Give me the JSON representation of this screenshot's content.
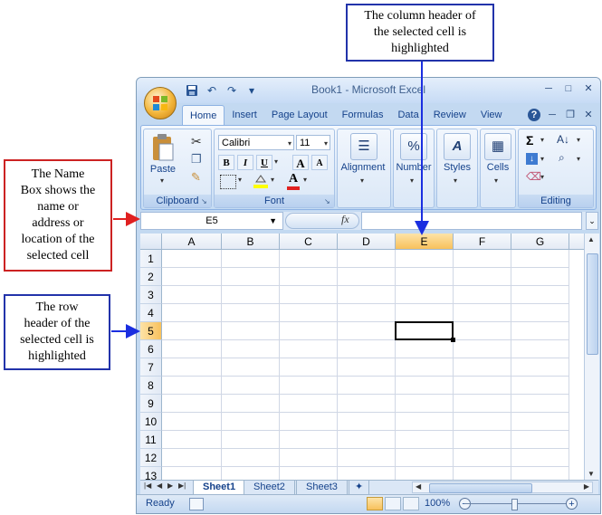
{
  "callouts": {
    "column_header": "The column header of\nthe selected cell is\nhighlighted",
    "name_box": "The Name\nBox shows the\nname or\naddress or\nlocation of the\nselected cell",
    "row_header": "The row\nheader of the\nselected cell is\nhighlighted"
  },
  "window": {
    "title": "Book1 - Microsoft Excel",
    "qat": [
      "save-icon",
      "undo-icon",
      "redo-icon",
      "customize-icon"
    ],
    "tabs": [
      "Home",
      "Insert",
      "Page Layout",
      "Formulas",
      "Data",
      "Review",
      "View"
    ],
    "active_tab": "Home"
  },
  "ribbon": {
    "clipboard": {
      "label": "Clipboard",
      "paste": "Paste"
    },
    "font": {
      "label": "Font",
      "name": "Calibri",
      "size": "11",
      "bold": "B",
      "italic": "I",
      "underline": "U",
      "grow": "A",
      "shrink": "A",
      "color": "A"
    },
    "alignment": {
      "label": "Alignment"
    },
    "number": {
      "label": "Number",
      "icon": "%"
    },
    "styles": {
      "label": "Styles",
      "icon": "A"
    },
    "cells": {
      "label": "Cells"
    },
    "editing": {
      "label": "Editing",
      "sum": "Σ"
    }
  },
  "formula_bar": {
    "name_box": "E5",
    "fx": "fx",
    "formula": ""
  },
  "grid": {
    "columns": [
      "A",
      "B",
      "C",
      "D",
      "E",
      "F",
      "G"
    ],
    "rows": [
      "1",
      "2",
      "3",
      "4",
      "5",
      "6",
      "7",
      "8",
      "9",
      "10",
      "11",
      "12",
      "13"
    ],
    "selected_column": "E",
    "selected_row": "5"
  },
  "sheets": [
    "Sheet1",
    "Sheet2",
    "Sheet3"
  ],
  "active_sheet": "Sheet1",
  "status": {
    "ready": "Ready",
    "zoom": "100%",
    "zoom_out": "−",
    "zoom_in": "+"
  },
  "colors": {
    "accent": "#f8c15c",
    "ribbon": "#dbe7f6",
    "red_arrow": "#e02020",
    "blue_arrow": "#1a2ee0"
  }
}
